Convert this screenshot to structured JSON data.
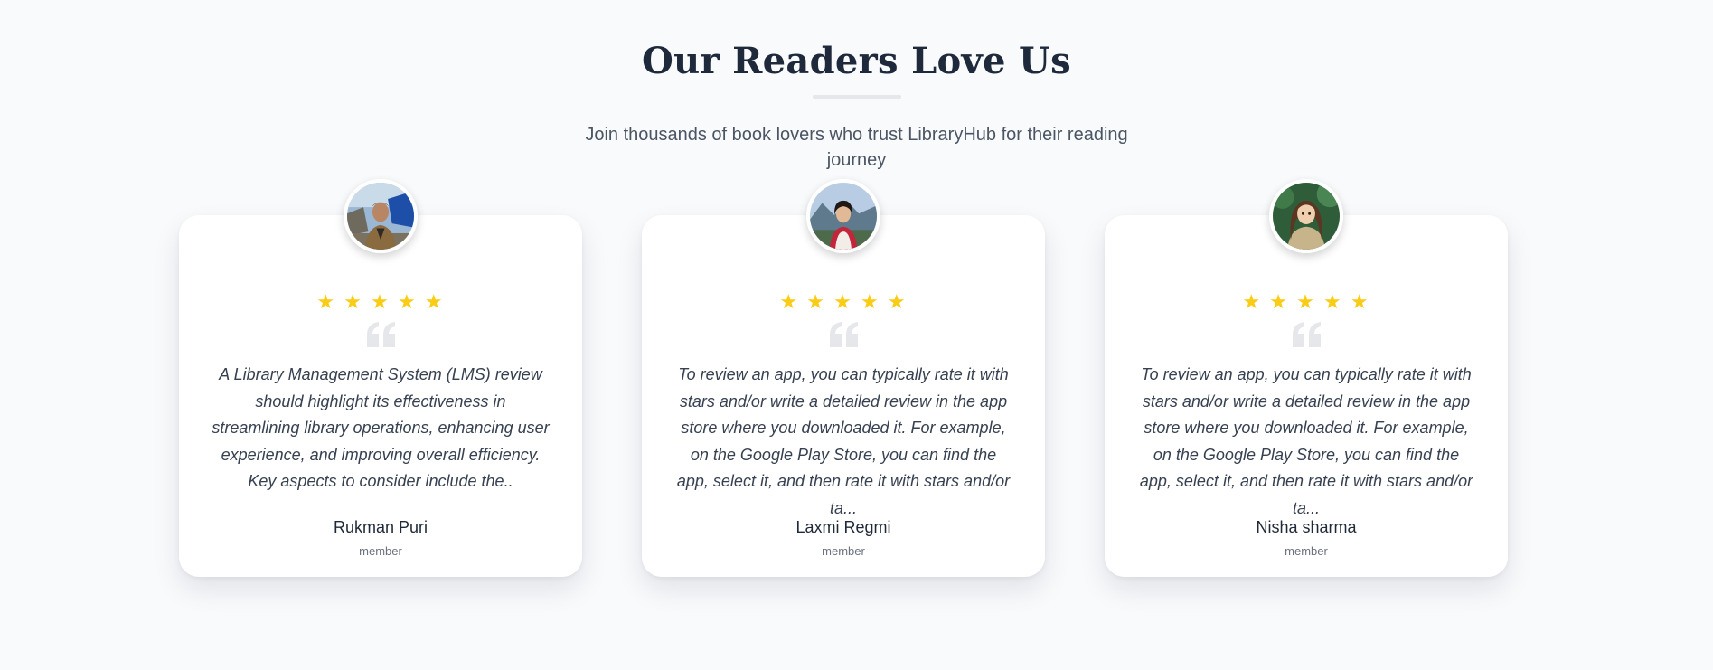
{
  "section": {
    "title": "Our Readers Love Us",
    "subtitle": "Join thousands of book lovers who trust LibraryHub for their reading journey"
  },
  "colors": {
    "star": "#facc15",
    "title": "#1e293b",
    "quote_icon": "#e5e7eb",
    "background": "#f8fafc"
  },
  "testimonials": [
    {
      "rating": 5,
      "review": "A Library Management System (LMS) review should highlight its effectiveness in streamlining library operations, enhancing user experience, and improving overall efficiency. Key aspects to consider include the..",
      "name": "Rukman Puri",
      "role": "member",
      "avatar_icon": "avatar-photo-man"
    },
    {
      "rating": 5,
      "review": "To review an app, you can typically rate it with stars and/or write a detailed review in the app store where you downloaded it. For example, on the Google Play Store, you can find the app, select it, and then rate it with stars and/or ta...",
      "name": "Laxmi Regmi",
      "role": "member",
      "avatar_icon": "avatar-photo-woman"
    },
    {
      "rating": 5,
      "review": "To review an app, you can typically rate it with stars and/or write a detailed review in the app store where you downloaded it. For example, on the Google Play Store, you can find the app, select it, and then rate it with stars and/or ta...",
      "name": "Nisha sharma",
      "role": "member",
      "avatar_icon": "avatar-illustration-woman"
    }
  ]
}
